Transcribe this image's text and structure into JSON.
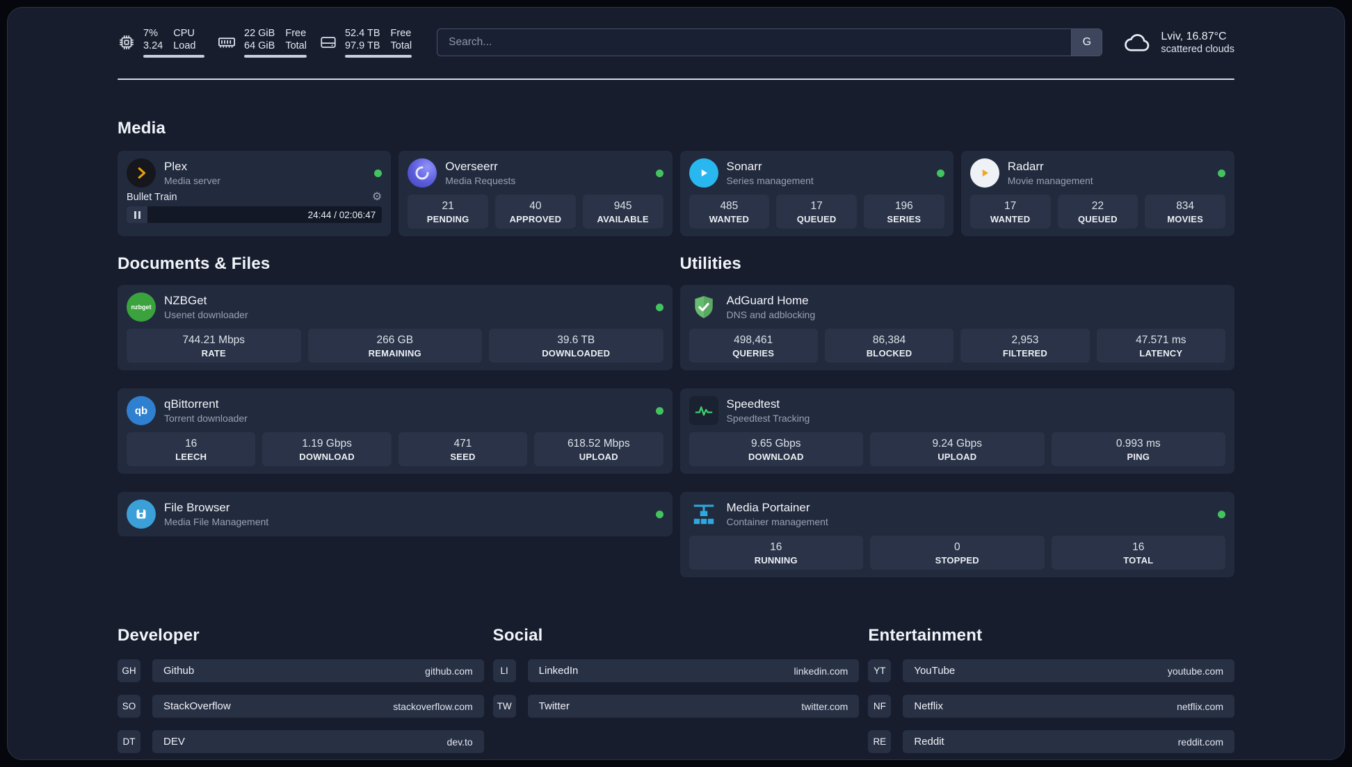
{
  "colors": {
    "status_online": "#43c35f",
    "panel_bg": "#171d2d",
    "card_bg": "#222a3d",
    "stat_bg": "#2a3347",
    "divider": "#d6dce6",
    "accent_green": "#3ed06e"
  },
  "glyphs": {
    "gear": "⚙"
  },
  "topbar": {
    "cpu": {
      "value_top": "7%",
      "value_bottom": "3.24",
      "label_top": "CPU",
      "label_bottom": "Load"
    },
    "memory": {
      "value_top": "22 GiB",
      "value_bottom": "64 GiB",
      "label_top": "Free",
      "label_bottom": "Total"
    },
    "disk": {
      "value_top": "52.4 TB",
      "value_bottom": "97.9 TB",
      "label_top": "Free",
      "label_bottom": "Total"
    },
    "search": {
      "placeholder": "Search...",
      "engine_button": "G"
    },
    "weather": {
      "location": "Lviv, 16.87°C",
      "condition": "scattered clouds"
    }
  },
  "sections": {
    "media": "Media",
    "documents": "Documents & Files",
    "utilities": "Utilities",
    "developer": "Developer",
    "social": "Social",
    "entertainment": "Entertainment"
  },
  "apps": {
    "plex": {
      "name": "Plex",
      "subtitle": "Media server",
      "player": {
        "title": "Bullet Train",
        "time": "24:44 / 02:06:47"
      }
    },
    "overseerr": {
      "name": "Overseerr",
      "subtitle": "Media Requests",
      "stats": [
        {
          "value": "21",
          "label": "PENDING"
        },
        {
          "value": "40",
          "label": "APPROVED"
        },
        {
          "value": "945",
          "label": "AVAILABLE"
        }
      ]
    },
    "sonarr": {
      "name": "Sonarr",
      "subtitle": "Series management",
      "stats": [
        {
          "value": "485",
          "label": "WANTED"
        },
        {
          "value": "17",
          "label": "QUEUED"
        },
        {
          "value": "196",
          "label": "SERIES"
        }
      ]
    },
    "radarr": {
      "name": "Radarr",
      "subtitle": "Movie management",
      "stats": [
        {
          "value": "17",
          "label": "WANTED"
        },
        {
          "value": "22",
          "label": "QUEUED"
        },
        {
          "value": "834",
          "label": "MOVIES"
        }
      ]
    },
    "nzbget": {
      "name": "NZBGet",
      "subtitle": "Usenet downloader",
      "icon_text": "nzbget",
      "stats": [
        {
          "value": "744.21 Mbps",
          "label": "RATE"
        },
        {
          "value": "266 GB",
          "label": "REMAINING"
        },
        {
          "value": "39.6 TB",
          "label": "DOWNLOADED"
        }
      ]
    },
    "qbittorrent": {
      "name": "qBittorrent",
      "subtitle": "Torrent downloader",
      "icon_text": "qb",
      "stats": [
        {
          "value": "16",
          "label": "LEECH"
        },
        {
          "value": "1.19 Gbps",
          "label": "DOWNLOAD"
        },
        {
          "value": "471",
          "label": "SEED"
        },
        {
          "value": "618.52 Mbps",
          "label": "UPLOAD"
        }
      ]
    },
    "filebrowser": {
      "name": "File Browser",
      "subtitle": "Media File Management"
    },
    "adguard": {
      "name": "AdGuard Home",
      "subtitle": "DNS and adblocking",
      "stats": [
        {
          "value": "498,461",
          "label": "QUERIES"
        },
        {
          "value": "86,384",
          "label": "BLOCKED"
        },
        {
          "value": "2,953",
          "label": "FILTERED"
        },
        {
          "value": "47.571 ms",
          "label": "LATENCY"
        }
      ]
    },
    "speedtest": {
      "name": "Speedtest",
      "subtitle": "Speedtest Tracking",
      "stats": [
        {
          "value": "9.65 Gbps",
          "label": "DOWNLOAD"
        },
        {
          "value": "9.24 Gbps",
          "label": "UPLOAD"
        },
        {
          "value": "0.993 ms",
          "label": "PING"
        }
      ]
    },
    "portainer": {
      "name": "Media Portainer",
      "subtitle": "Container management",
      "stats": [
        {
          "value": "16",
          "label": "RUNNING"
        },
        {
          "value": "0",
          "label": "STOPPED"
        },
        {
          "value": "16",
          "label": "TOTAL"
        }
      ]
    }
  },
  "bookmarks": {
    "developer": [
      {
        "abbr": "GH",
        "name": "Github",
        "url": "github.com"
      },
      {
        "abbr": "SO",
        "name": "StackOverflow",
        "url": "stackoverflow.com"
      },
      {
        "abbr": "DT",
        "name": "DEV",
        "url": "dev.to"
      }
    ],
    "social": [
      {
        "abbr": "LI",
        "name": "LinkedIn",
        "url": "linkedin.com"
      },
      {
        "abbr": "TW",
        "name": "Twitter",
        "url": "twitter.com"
      }
    ],
    "entertainment": [
      {
        "abbr": "YT",
        "name": "YouTube",
        "url": "youtube.com"
      },
      {
        "abbr": "NF",
        "name": "Netflix",
        "url": "netflix.com"
      },
      {
        "abbr": "RE",
        "name": "Reddit",
        "url": "reddit.com"
      }
    ]
  }
}
